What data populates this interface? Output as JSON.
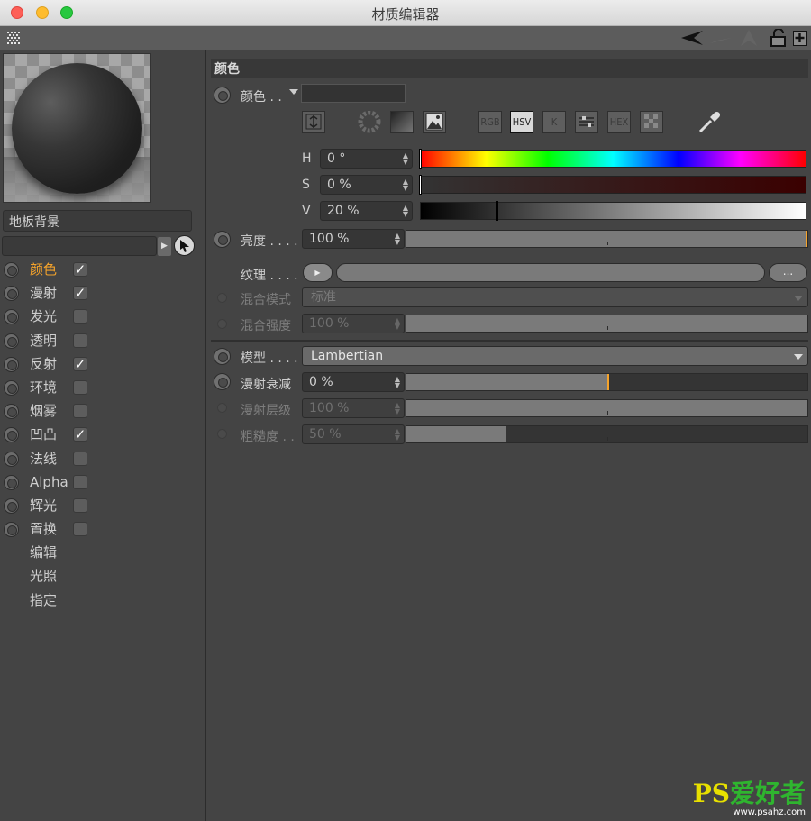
{
  "window": {
    "title": "材质编辑器"
  },
  "left": {
    "material_name": "地板背景",
    "channels": [
      {
        "label": "颜色",
        "checked": true,
        "active": true,
        "radio": true
      },
      {
        "label": "漫射",
        "checked": true,
        "active": false,
        "radio": true
      },
      {
        "label": "发光",
        "checked": false,
        "active": false,
        "radio": true
      },
      {
        "label": "透明",
        "checked": false,
        "active": false,
        "radio": true
      },
      {
        "label": "反射",
        "checked": true,
        "active": false,
        "radio": true
      },
      {
        "label": "环境",
        "checked": false,
        "active": false,
        "radio": true
      },
      {
        "label": "烟雾",
        "checked": false,
        "active": false,
        "radio": true
      },
      {
        "label": "凹凸",
        "checked": true,
        "active": false,
        "radio": true
      },
      {
        "label": "法线",
        "checked": false,
        "active": false,
        "radio": true
      },
      {
        "label": "Alpha",
        "checked": false,
        "active": false,
        "radio": true
      },
      {
        "label": "辉光",
        "checked": false,
        "active": false,
        "radio": true
      },
      {
        "label": "置换",
        "checked": false,
        "active": false,
        "radio": true
      },
      {
        "label": "编辑",
        "checked": null,
        "active": false,
        "radio": false
      },
      {
        "label": "光照",
        "checked": null,
        "active": false,
        "radio": false
      },
      {
        "label": "指定",
        "checked": null,
        "active": false,
        "radio": false
      }
    ],
    "check_mark": "✓"
  },
  "right": {
    "section_title": "颜色",
    "color_label": "颜色 . .",
    "color_mode_buttons": [
      "RGB",
      "HSV",
      "K",
      "",
      "HEX",
      ""
    ],
    "color_mode_selected": "HSV",
    "h": {
      "label": "H",
      "value": "0 °",
      "fraction": 0.0
    },
    "s": {
      "label": "S",
      "value": "0 %",
      "fraction": 0.0
    },
    "v": {
      "label": "V",
      "value": "20 %",
      "fraction": 0.2
    },
    "brightness": {
      "label": "亮度 . . . .",
      "value": "100 %",
      "fraction": 1.0
    },
    "texture": {
      "label": "纹理 . . . .",
      "more": "..."
    },
    "blend_mode": {
      "label": "混合模式",
      "value": "标准"
    },
    "blend_strength": {
      "label": "混合强度",
      "value": "100 %",
      "fraction": 1.0
    },
    "model": {
      "label": "模型 . . . .",
      "value": "Lambertian"
    },
    "diffuse_falloff": {
      "label": "漫射衰减",
      "value": "0 %",
      "fraction": 0.5
    },
    "diffuse_level": {
      "label": "漫射层级",
      "value": "100 %",
      "fraction": 1.0
    },
    "roughness": {
      "label": "粗糙度 . .",
      "value": "50 %",
      "fraction": 0.25
    }
  },
  "watermark": {
    "main_ps": "PS",
    "main_text": "爱好者",
    "sub": "www.psahz.com"
  },
  "colors": {
    "accent": "#f5a32b",
    "background": "#444444"
  }
}
